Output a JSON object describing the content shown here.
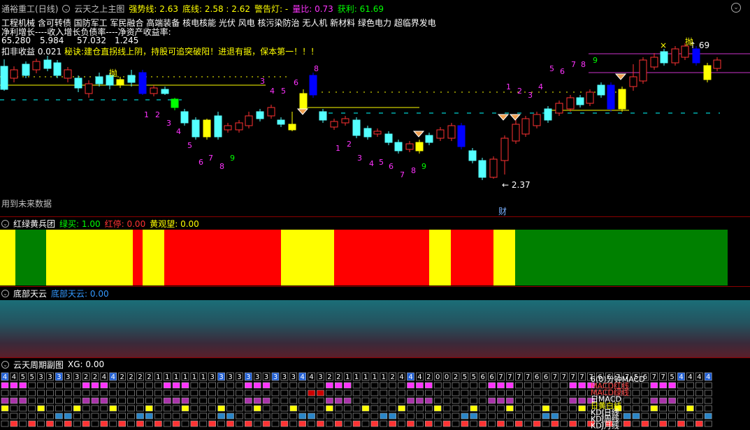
{
  "main": {
    "stock_name": "通裕重工",
    "period": "(日线)",
    "indicator_name": "云天之上主图",
    "strong_label": "强势线:",
    "strong_value": "2.63",
    "bottom_label": "底线:",
    "bottom_value": "2.58",
    "bottom_value2": "2.62",
    "alarm_label": "警告灯:",
    "alarm_value": "-",
    "volume_label": "量比:",
    "volume_value": "0.73",
    "profit_label": "获利:",
    "profit_value": "61.69",
    "concepts": "工程机械 含可转债 国防军工 军民融合 高端装备 核电核能 光伏 风电 核污染防治 无人机 新材料 绿色电力 超临界发电",
    "finance_header": "净利增长----收入增长负债率----净资产收益率:",
    "finance_values": [
      "65.280",
      "5.984",
      "57.032",
      "1.245"
    ],
    "eps_text": "扣非收益",
    "eps_value": "0.021",
    "tip_label": "秘诀:",
    "tip_text": "建仓直拐线上阴，持股可追突破阳！进退有据，保本第一！！！",
    "future_data": "用到未来数据",
    "low_price": "2.37",
    "high_price": "69",
    "throw1": "抛",
    "throw2": "抛",
    "fin_mark": "财",
    "cross_mark": "×"
  },
  "panel2": {
    "title": "红绿黄兵团",
    "buy_label": "绿买:",
    "buy_value": "1.00",
    "stop_label": "红停:",
    "stop_value": "0.00",
    "watch_label": "黄观望:",
    "watch_value": "0.00",
    "bands": [
      "yellow",
      "green",
      "yellow",
      "red",
      "yellow",
      "red",
      "yellow",
      "red",
      "yellow",
      "red",
      "yellow",
      "green"
    ]
  },
  "panel3": {
    "title": "底部天云",
    "label": "底部天云:",
    "value": "0.00"
  },
  "panel4": {
    "title": "云天周期副图",
    "xg_label": "XG:",
    "xg_value": "0.00",
    "digits": "4455333332244222211111133333333334432211111244420025566777766777776677567754444",
    "rows": [
      "6(0)分钟MACD",
      "MACD红线",
      "MACD绿线",
      "日MACD",
      "日黄白线",
      "KDJ日线",
      "KDJ周线",
      "KDJ月线"
    ]
  },
  "colors": {
    "up": "#ff3232",
    "down": "#54ffff",
    "blue_bar": "#0000ff",
    "yellow": "#ffff00",
    "magenta": "#ff33ff",
    "green": "#00ff00",
    "band_red": "#ff0000",
    "band_green": "#008000",
    "band_yellow": "#ffff00"
  }
}
